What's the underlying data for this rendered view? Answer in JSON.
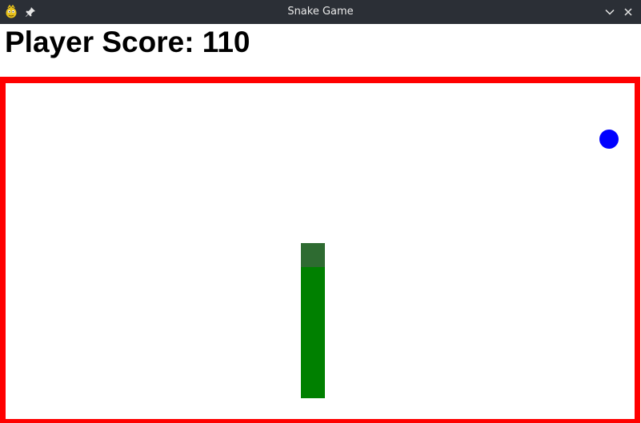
{
  "window": {
    "title": "Snake Game"
  },
  "hud": {
    "score_text": "Player Score: 110"
  },
  "colors": {
    "arena_border": "#ff0000",
    "snake_body": "#008000",
    "snake_head": "#2e6b31",
    "food": "#0000ff"
  },
  "icons": {
    "app": "pygame-snake-logo-icon",
    "pin": "pin-icon",
    "minimize": "chevron-down-icon",
    "close": "close-icon"
  }
}
